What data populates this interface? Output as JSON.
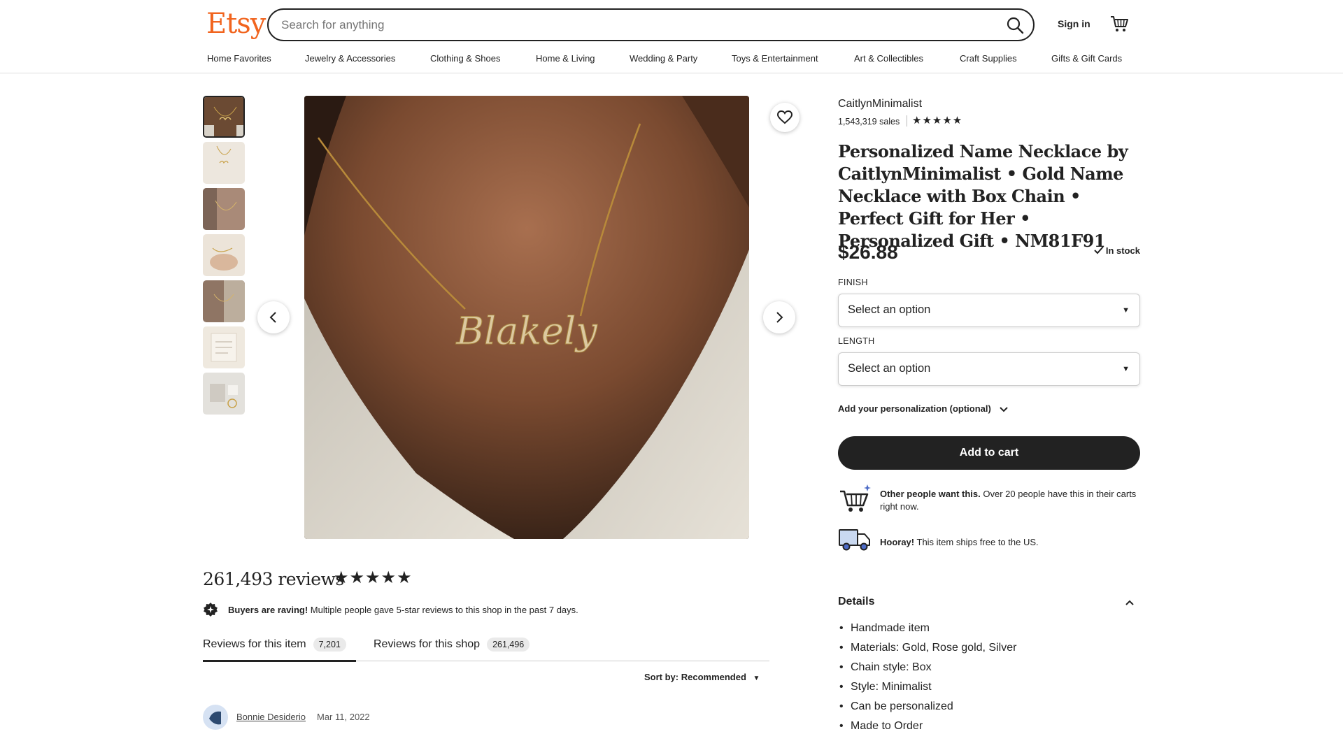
{
  "header": {
    "logo": "Etsy",
    "search_placeholder": "Search for anything",
    "signin_label": "Sign in",
    "nav": [
      "Home Favorites",
      "Jewelry & Accessories",
      "Clothing & Shoes",
      "Home & Living",
      "Wedding & Party",
      "Toys & Entertainment",
      "Art & Collectibles",
      "Craft Supplies",
      "Gifts & Gift Cards"
    ]
  },
  "product": {
    "shop_name": "CaitlynMinimalist",
    "sales": "1,543,319 sales",
    "shop_stars": "★★★★★",
    "title": "Personalized Name Necklace by CaitlynMinimalist • Gold Name Necklace with Box Chain • Perfect Gift for Her • Personalized Gift • NM81F91",
    "price": "$26.88",
    "stock": "In stock",
    "image_text": "Blakely",
    "finish_label": "FINISH",
    "finish_value": "Select an option",
    "length_label": "LENGTH",
    "length_value": "Select an option",
    "personalization": "Add your personalization (optional)",
    "add_to_cart": "Add to cart",
    "demand_bold": "Other people want this.",
    "demand_text": " Over 20 people have this in their carts right now.",
    "ship_bold": "Hooray!",
    "ship_text": " This item ships free to the US.",
    "details_heading": "Details",
    "details": [
      "Handmade item",
      "Materials: Gold, Rose gold, Silver",
      "Chain style: Box",
      "Style: Minimalist",
      "Can be personalized",
      "Made to Order"
    ]
  },
  "reviews": {
    "count_text": "261,493 reviews",
    "stars": "★★★★★",
    "raving_bold": "Buyers are raving!",
    "raving_text": " Multiple people gave 5-star reviews to this shop in the past 7 days.",
    "tab_item_label": "Reviews for this item",
    "tab_item_count": "7,201",
    "tab_shop_label": "Reviews for this shop",
    "tab_shop_count": "261,496",
    "sort_label": "Sort by: Recommended",
    "first_reviewer": "Bonnie Desiderio",
    "first_date": "Mar 11, 2022"
  },
  "colors": {
    "brand": "#F1641E",
    "text": "#222222",
    "button": "#222222"
  },
  "icons": [
    "search-icon",
    "cart-icon",
    "heart-icon",
    "chevron-left-icon",
    "chevron-right-icon",
    "checkmark-icon",
    "chevron-down-icon",
    "chevron-up-icon",
    "shopping-cart-illustration",
    "delivery-truck-illustration",
    "sparkle-badge-icon"
  ]
}
